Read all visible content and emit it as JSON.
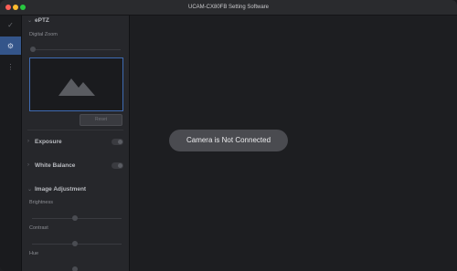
{
  "window": {
    "title": "UCAM-CX80FB Setting Software"
  },
  "rail": {
    "items": [
      {
        "icon": "check-icon",
        "glyph": "✓"
      },
      {
        "icon": "gear-icon",
        "glyph": "⚙"
      },
      {
        "icon": "more-icon",
        "glyph": "⋮"
      }
    ]
  },
  "panel": {
    "eptz_title": "ePTZ",
    "digital_zoom_label": "Digital Zoom",
    "reset_label": "Reset",
    "exposure_label": "Exposure",
    "white_balance_label": "White Balance",
    "image_adjustment_label": "Image Adjustment",
    "brightness_label": "Brightness",
    "contrast_label": "Contrast",
    "hue_label": "Hue"
  },
  "main": {
    "status_text": "Camera is Not Connected"
  }
}
